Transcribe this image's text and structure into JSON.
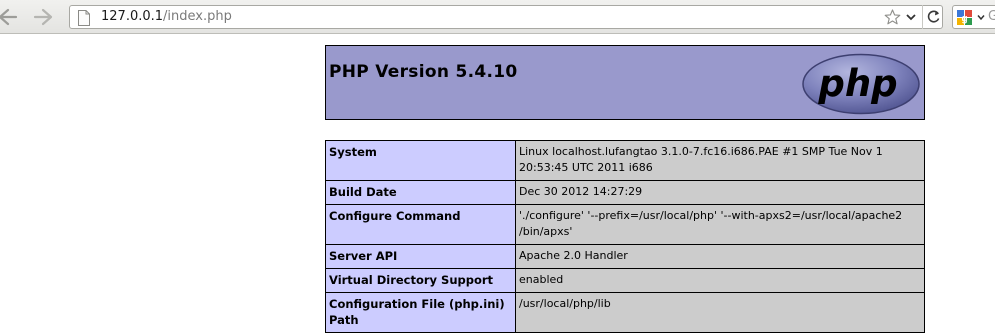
{
  "browser": {
    "url_host": "127.0.0.1",
    "url_path": "/index.php",
    "search_placeholder": "G"
  },
  "php_header": {
    "title": "PHP Version 5.4.10",
    "logo_text": "php"
  },
  "info_table": {
    "rows": [
      {
        "label": "System",
        "value": "Linux localhost.lufangtao 3.1.0-7.fc16.i686.PAE #1 SMP Tue Nov 1 20:53:45 UTC 2011 i686"
      },
      {
        "label": "Build Date",
        "value": "Dec 30 2012 14:27:29"
      },
      {
        "label": "Configure Command",
        "value": "'./configure' '--prefix=/usr/local/php' '--with-apxs2=/usr/local/apache2 /bin/apxs'"
      },
      {
        "label": "Server API",
        "value": "Apache 2.0 Handler"
      },
      {
        "label": "Virtual Directory Support",
        "value": "enabled"
      },
      {
        "label": "Configuration File (php.ini) Path",
        "value": "/usr/local/php/lib"
      }
    ]
  },
  "colors": {
    "header_bg": "#9999cc",
    "label_bg": "#ccccff",
    "value_bg": "#cccccc"
  }
}
